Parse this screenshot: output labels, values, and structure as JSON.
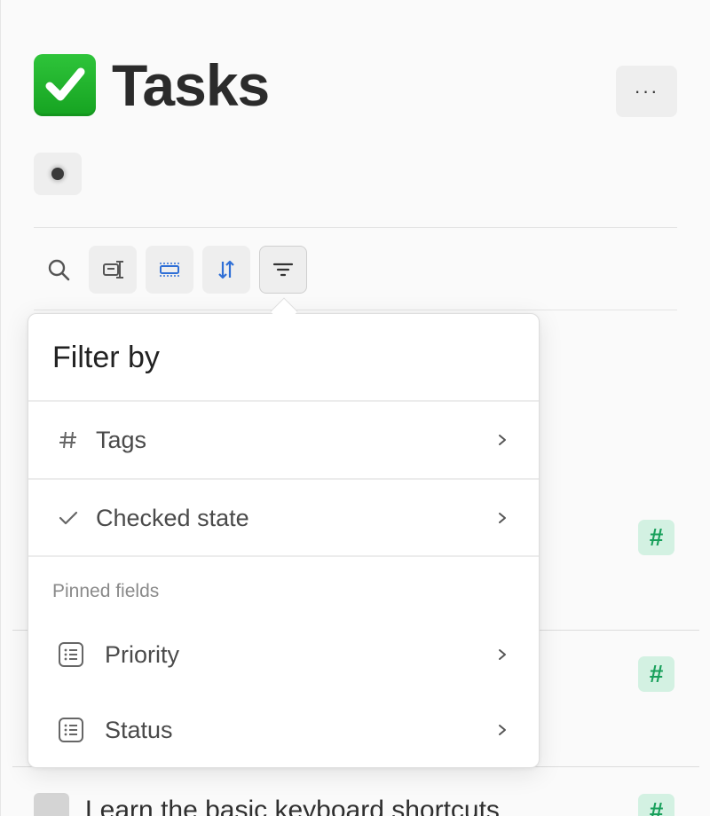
{
  "page": {
    "title": "Tasks",
    "title_icon": "check-mark-button-emoji",
    "more_label": "···"
  },
  "toolbar": {
    "icons": [
      "search-icon",
      "toggle-properties-icon",
      "layout-icon",
      "sort-icon",
      "filter-icon"
    ]
  },
  "filter_popover": {
    "title": "Filter by",
    "items": [
      {
        "label": "Tags",
        "icon": "hash-icon"
      },
      {
        "label": "Checked state",
        "icon": "checkmark-icon"
      }
    ],
    "pinned_section_label": "Pinned fields",
    "pinned_items": [
      {
        "label": "Priority",
        "icon": "list-icon"
      },
      {
        "label": "Status",
        "icon": "list-icon"
      }
    ]
  },
  "tag_chip_label": "#",
  "rows": [
    {
      "text": "Learn the basic keyboard shortcuts"
    }
  ],
  "colors": {
    "accent_green": "#18a05b",
    "tag_bg": "#d3f1e2",
    "emoji_green": "#1fb52c",
    "toolbar_blue": "#2f6fd6"
  }
}
